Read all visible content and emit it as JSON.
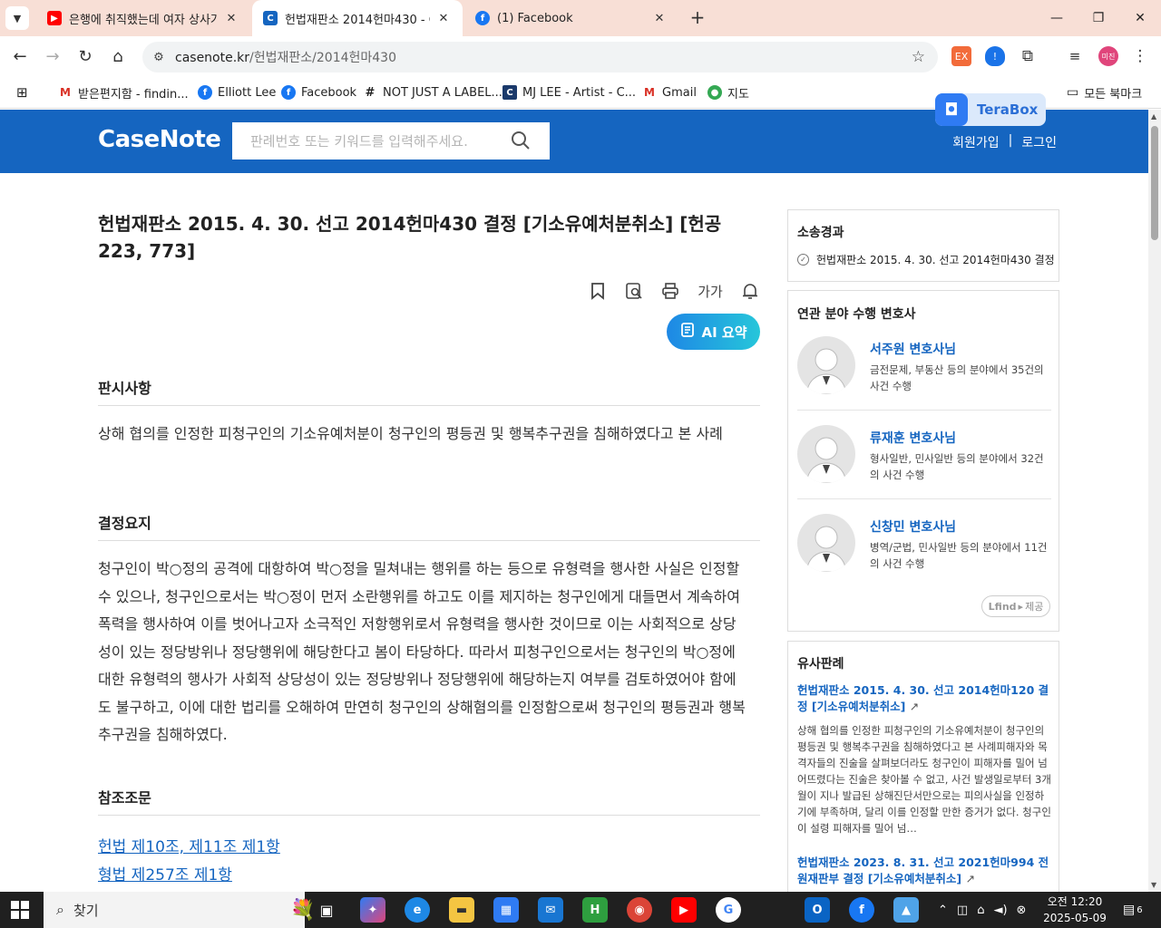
{
  "browser": {
    "tabs": [
      {
        "title": "은행에 취직했는데 여자 상사가",
        "favicon": "youtube-icon",
        "color": "#ff0000"
      },
      {
        "title": "헌법재판소 2014헌마430 - Cas",
        "favicon": "casenote-icon",
        "color": "#1565c0"
      },
      {
        "title": "(1) Facebook",
        "favicon": "facebook-icon",
        "color": "#1877f2"
      }
    ],
    "url_host": "casenote.kr",
    "url_path": "/헌법재판소/2014헌마430",
    "bookmarks": [
      {
        "label": "받은편지함 - findin...",
        "icon": "gmail-icon"
      },
      {
        "label": "Elliott Lee",
        "icon": "facebook-icon"
      },
      {
        "label": "Facebook",
        "icon": "facebook-icon"
      },
      {
        "label": "NOT JUST A LABEL...",
        "icon": "njal-icon"
      },
      {
        "label": "MJ LEE - Artist - C...",
        "icon": "c-icon"
      },
      {
        "label": "Gmail",
        "icon": "gmail-icon"
      },
      {
        "label": "지도",
        "icon": "maps-pin-icon"
      }
    ],
    "all_bookmarks": "모든 북마크",
    "profile_initials": "미진",
    "terabox": "TeraBox"
  },
  "site": {
    "logo": "CaseNote",
    "search_placeholder": "판례번호 또는 키워드를 입력해주세요.",
    "signup": "회원가입",
    "separator": "|",
    "login": "로그인"
  },
  "case": {
    "title": "헌법재판소 2015. 4. 30. 선고 2014헌마430 결정 [기소유예처분취소] [헌공223, 773]",
    "font_size_tool": "가가",
    "ai_summary": "AI 요약",
    "sections": {
      "issue_heading": "판시사항",
      "issue_text": "상해 협의를 인정한 피청구인의 기소유예처분이 청구인의 평등권 및 행복추구권을 침해하였다고 본 사례",
      "holding_heading": "결정요지",
      "holding_text": "청구인이 박○정의 공격에 대항하여 박○정을 밀쳐내는 행위를 하는 등으로 유형력을 행사한 사실은 인정할 수 있으나, 청구인으로서는 박○정이 먼저 소란행위를 하고도 이를 제지하는 청구인에게 대들면서 계속하여 폭력을 행사하여 이를 벗어나고자 소극적인 저항행위로서 유형력을 행사한 것이므로 이는 사회적으로 상당성이 있는 정당방위나 정당행위에 해당한다고 봄이 타당하다. 따라서 피청구인으로서는 청구인의 박○정에 대한 유형력의 행사가 사회적 상당성이 있는 정당방위나 정당행위에 해당하는지 여부를 검토하였어야 함에도 불구하고, 이에 대한 법리를 오해하여 만연히 청구인의 상해혐의를 인정함으로써 청구인의 평등권과 행복추구권을 침해하였다.",
      "refs_heading": "참조조문",
      "refs": [
        "헌법 제10조, 제11조 제1항",
        "형법 제257조 제1항"
      ]
    }
  },
  "sidebar": {
    "history_heading": "소송경과",
    "history_item": "헌법재판소 2015. 4. 30. 선고 2014헌마430 결정",
    "lawyers_heading": "연관 분야 수행 변호사",
    "lawyers": [
      {
        "name": "서주원 변호사님",
        "desc": "금전문제, 부동산 등의 분야에서 35건의 사건 수행"
      },
      {
        "name": "류재훈 변호사님",
        "desc": "형사일반, 민사일반 등의 분야에서 32건의 사건 수행"
      },
      {
        "name": "신창민 변호사님",
        "desc": "병역/군법, 민사일반 등의 분야에서 11건의 사건 수행"
      }
    ],
    "lfind_brand": "Lfind",
    "lfind_provided": "제공",
    "similar_heading": "유사판례",
    "similar": [
      {
        "title": "헌법재판소 2015. 4. 30. 선고 2014헌마120 결정 [기소유예처분취소]",
        "body": "상해 협의를 인정한 피청구인의 기소유예처분이 청구인의 평등권 및 행복추구권을 침해하였다고 본 사례피해자와 목격자들의 진술을 살펴보더라도 청구인이 피해자를 밀어 넘어뜨렸다는 진술은 찾아볼 수 없고, 사건 발생일로부터 3개월이 지나 발급된 상해진단서만으로는 피의사실을 인정하기에 부족하며, 달리 이를 인정할 만한 증거가 없다. 청구인이 설령 피해자를 밀어 넘…"
      },
      {
        "title": "헌법재판소 2023. 8. 31. 선고 2021헌마994 전원재판부 결정 [기소유예처분취소]",
        "body": ""
      }
    ]
  },
  "taskbar": {
    "search_label": "찾기",
    "time": "오전 12:20",
    "date": "2025-05-09",
    "notification_count": "6"
  }
}
